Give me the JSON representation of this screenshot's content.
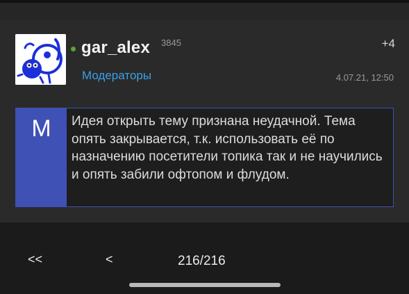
{
  "post": {
    "username": "gar_alex",
    "reputation": "3845",
    "rating": "+4",
    "group": "Модераторы",
    "date": "4.07.21, 12:50",
    "online_status_color": "#5aa23c",
    "avatar_icon": "cartoon-blue-bird-icon"
  },
  "moderator_note": {
    "letter": "M",
    "text": "Идея открыть тему признана неудачной. Тема опять закрывается, т.к. использовать её по назначению посетители топика так и не научились и опять забили офтопом и флудом.",
    "accent_color": "#3f51b5"
  },
  "navigation": {
    "first_label": "<<",
    "prev_label": "<",
    "page_indicator": "216/216"
  }
}
